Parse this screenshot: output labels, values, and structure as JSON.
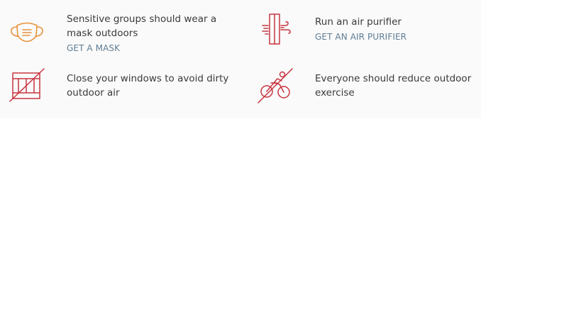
{
  "colors": {
    "panel_background": "#fafafa",
    "text": "#3a3a3a",
    "link": "#5f7d95",
    "mask_icon": "#e8923a",
    "alert_icon": "#c8343f"
  },
  "recommendations": [
    {
      "icon": "face-mask-icon",
      "text": "Sensitive groups should wear a mask outdoors",
      "link": "GET A MASK"
    },
    {
      "icon": "air-purifier-icon",
      "text": "Run an air purifier",
      "link": "GET AN AIR PURIFIER"
    },
    {
      "icon": "closed-window-icon",
      "text": "Close your windows to avoid dirty outdoor air",
      "link": ""
    },
    {
      "icon": "no-cycling-icon",
      "text": "Everyone should reduce outdoor exercise",
      "link": ""
    }
  ]
}
